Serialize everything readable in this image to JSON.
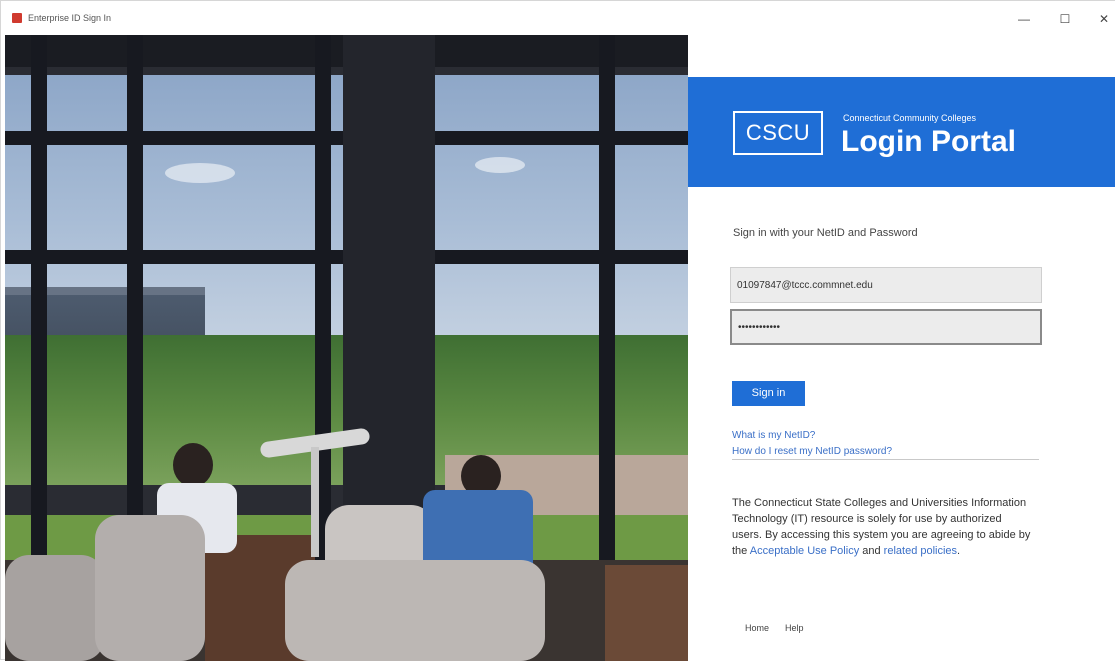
{
  "window": {
    "title": "Enterprise ID Sign In",
    "minimize": "—",
    "maximize": "☐",
    "close": "✕"
  },
  "brand": {
    "logo_text": "CSCU",
    "subtitle": "Connecticut Community Colleges",
    "title": "Login Portal",
    "color": "#1f6ed6"
  },
  "form": {
    "heading": "Sign in with your NetID and Password",
    "username_value": "01097847@tccc.commnet.edu",
    "password_value": "••••••••••••",
    "signin_label": "Sign in"
  },
  "links": {
    "what_netid": "What is my NetID?",
    "reset_password": "How do I reset my NetID password?"
  },
  "notice": {
    "text_before": "The Connecticut State Colleges and Universities Information Technology (IT) resource is solely for use by authorized users. By accessing this system you are agreeing to abide by the ",
    "link_policy": "Acceptable Use Policy",
    "text_middle": " and ",
    "link_related": "related policies",
    "text_after": "."
  },
  "footer": {
    "home": "Home",
    "help": "Help"
  }
}
